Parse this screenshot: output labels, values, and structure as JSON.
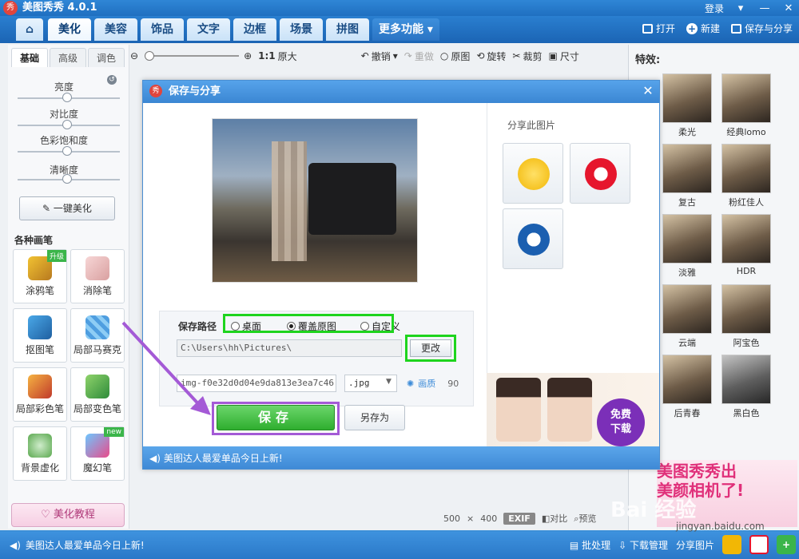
{
  "app": {
    "title": "美图秀秀 4.0.1",
    "logo_text": "秀",
    "login": "登录"
  },
  "nav": {
    "tabs": [
      {
        "label": "美化"
      },
      {
        "label": "美容"
      },
      {
        "label": "饰品"
      },
      {
        "label": "文字"
      },
      {
        "label": "边框"
      },
      {
        "label": "场景"
      },
      {
        "label": "拼图"
      }
    ],
    "more": "更多功能",
    "open": "打开",
    "new": "新建",
    "save_share": "保存与分享"
  },
  "left": {
    "subtabs": [
      "基础",
      "高级",
      "调色"
    ],
    "sliders": [
      "亮度",
      "对比度",
      "色彩饱和度",
      "清晰度"
    ],
    "onekey": "一键美化",
    "brush_heading": "各种画笔",
    "tools": [
      "涂鸦笔",
      "消除笔",
      "抠图笔",
      "局部马赛克",
      "局部彩色笔",
      "局部变色笔",
      "背景虚化",
      "魔幻笔"
    ],
    "tag_upgrade": "升级",
    "tag_new": "new",
    "tutorial": "美化教程"
  },
  "toolbar": {
    "ratio": "1:1",
    "original_size": "原大",
    "undo": "撤销",
    "redo": "重做",
    "original": "原图",
    "rotate": "旋转",
    "crop": "裁剪",
    "size": "尺寸"
  },
  "canvas": {
    "width": "500",
    "times": "×",
    "height": "400",
    "exif": "EXIF",
    "compare": "对比",
    "preview": "预览"
  },
  "effects": {
    "title": "特效:",
    "items": [
      "柔光",
      "经典lomo",
      "复古",
      "粉红佳人",
      "淡雅",
      "HDR",
      "云端",
      "阿宝色",
      "后青春",
      "黑白色"
    ],
    "banner_line1": "美图秀秀出",
    "banner_line2": "美颜相机了!"
  },
  "dialog": {
    "title": "保存与分享",
    "logo_text": "秀",
    "close": "✕",
    "path_label": "保存路径",
    "radio_desktop": "桌面",
    "radio_overwrite": "覆盖原图",
    "radio_custom": "自定义",
    "path_value": "C:\\Users\\hh\\Pictures\\",
    "change": "更改",
    "filename": "img-f0e32d0d04e9da813e3ea7c46",
    "ext": ".jpg",
    "quality_label": "画质",
    "quality_value": "90",
    "save": "保存",
    "save_as": "另存为",
    "share_title": "分享此图片",
    "free_line1": "免费",
    "free_line2": "下载",
    "footer": "美图达人最爱单品今日上新!"
  },
  "status": {
    "text": "美图达人最爱单品今日上新!",
    "batch": "批处理",
    "download": "下载管理",
    "share_img": "分享图片"
  },
  "watermark": {
    "brand": "Bai 经验",
    "url": "jingyan.baidu.com"
  },
  "colors": {
    "accent": "#2a78c8",
    "green_highlight": "#1ed41e",
    "purple_highlight": "#a45ad6",
    "save_green": "#2fae2f"
  }
}
